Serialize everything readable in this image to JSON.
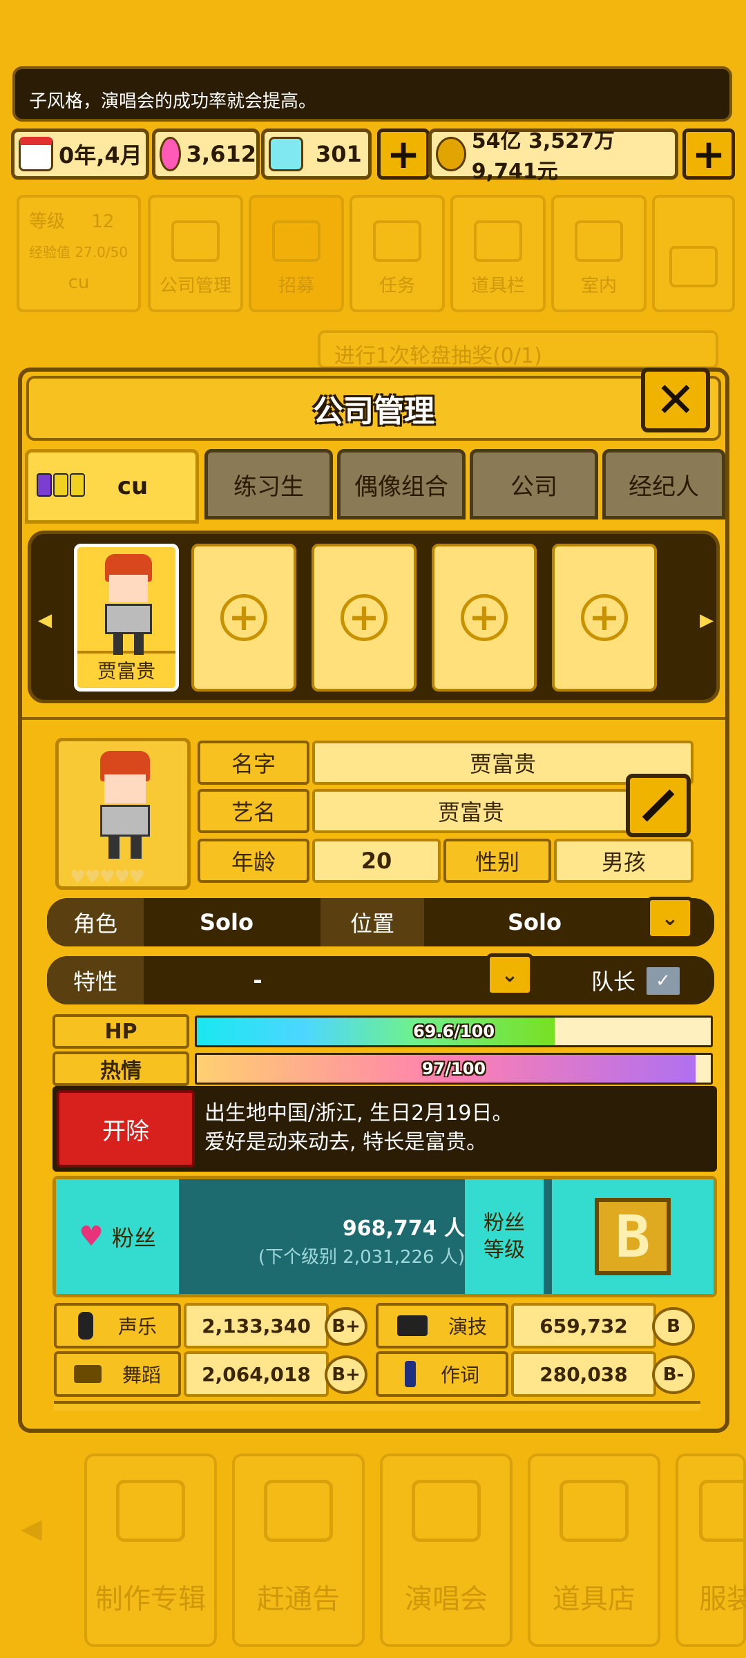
{
  "tip": "子风格，演唱会的成功率就会提高。",
  "resources": {
    "date": "0年,4月",
    "pink_gems": "3,612",
    "diamonds": "301",
    "money": "54亿 3,527万 9,741元"
  },
  "bg_menu": {
    "level_label": "等级",
    "level_value": "12",
    "exp_label": "经验值 27.0/50",
    "company_name": "cu",
    "items": [
      "公司管理",
      "招募",
      "任务",
      "道具栏",
      "室内"
    ],
    "quest_text": "进行1次轮盘抽奖(0/1)"
  },
  "dialog": {
    "title": "公司管理",
    "tabs": [
      "cu",
      "练习生",
      "偶像组合",
      "公司",
      "经纪人"
    ],
    "selected_member": "贾富贵"
  },
  "profile": {
    "name_label": "名字",
    "name": "贾富贵",
    "stage_label": "艺名",
    "stage_name": "贾富贵",
    "age_label": "年龄",
    "age": "20",
    "gender_label": "性别",
    "gender": "男孩",
    "role_label": "角色",
    "role": "Solo",
    "position_label": "位置",
    "position": "Solo",
    "trait_label": "特性",
    "trait": "-",
    "leader_label": "队长",
    "hp_label": "HP",
    "hp_text": "69.6/100",
    "hp_fraction": 0.696,
    "passion_label": "热情",
    "passion_text": "97/100",
    "passion_fraction": 0.97,
    "fire_label": "开除",
    "bio_line1": "出生地中国/浙江, 生日2月19日。",
    "bio_line2": "爱好是动来动去, 特长是富贵。",
    "fans_label": "粉丝",
    "fans_count": "968,774 人",
    "fans_next": "(下个级别 2,031,226 人)",
    "fans_level_label": "粉丝\n等级",
    "fans_grade": "B"
  },
  "stats": [
    {
      "label": "声乐",
      "value": "2,133,340",
      "grade": "B+"
    },
    {
      "label": "演技",
      "value": "659,732",
      "grade": "B"
    },
    {
      "label": "舞蹈",
      "value": "2,064,018",
      "grade": "B+"
    },
    {
      "label": "作词",
      "value": "280,038",
      "grade": "B-"
    }
  ],
  "bottom_nav": [
    "制作专辑",
    "赶通告",
    "演唱会",
    "道具店",
    "服装"
  ],
  "colors": {
    "accent": "#f5b80e",
    "dark": "#3a2600",
    "teal": "#33dccf",
    "danger": "#d8201c"
  }
}
